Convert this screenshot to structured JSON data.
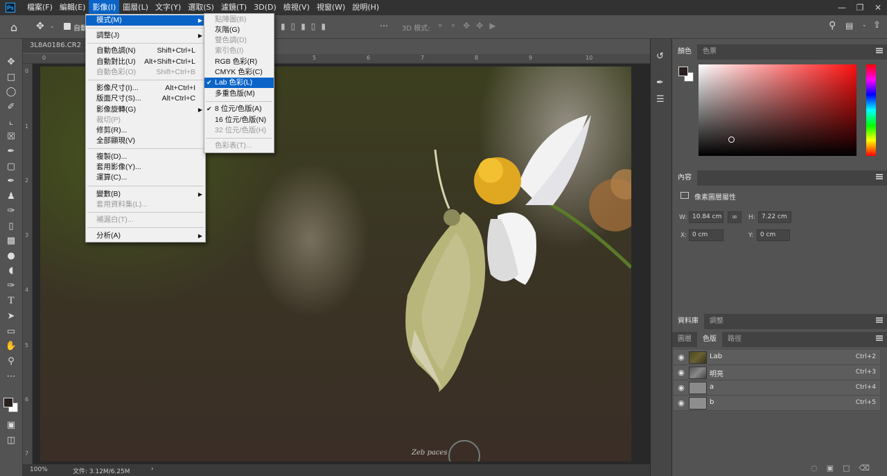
{
  "menubar": {
    "logo": "Ps",
    "items": [
      "檔案(F)",
      "編輯(E)",
      "影像(I)",
      "圖層(L)",
      "文字(Y)",
      "選取(S)",
      "濾鏡(T)",
      "3D(D)",
      "檢視(V)",
      "視窗(W)",
      "說明(H)"
    ]
  },
  "optbar": {
    "auto_select": "自動",
    "mode3d": "3D 模式:"
  },
  "document": {
    "tab": "3L8A0186.CR2 @",
    "ruler_top": [
      "0",
      "1",
      "2",
      "3",
      "4",
      "5",
      "6",
      "7",
      "8",
      "9",
      "10"
    ],
    "ruler_left": [
      "0",
      "1",
      "2",
      "3",
      "4",
      "5",
      "6",
      "7"
    ],
    "watermark": "Zeb paces",
    "status": {
      "zoom": "100%",
      "file": "文件: 3.12M/6.25M"
    }
  },
  "image_menu": {
    "items": [
      {
        "label": "模式(M)",
        "submenu": true,
        "highlight": true
      },
      {
        "label": "調整(J)",
        "submenu": true
      },
      {
        "label": "自動色調(N)",
        "shortcut": "Shift+Ctrl+L"
      },
      {
        "label": "自動對比(U)",
        "shortcut": "Alt+Shift+Ctrl+L"
      },
      {
        "label": "自動色彩(O)",
        "shortcut": "Shift+Ctrl+B",
        "disabled": true
      },
      {
        "label": "影像尺寸(I)...",
        "shortcut": "Alt+Ctrl+I"
      },
      {
        "label": "版面尺寸(S)...",
        "shortcut": "Alt+Ctrl+C"
      },
      {
        "label": "影像旋轉(G)",
        "submenu": true
      },
      {
        "label": "裁切(P)",
        "disabled": true
      },
      {
        "label": "修剪(R)..."
      },
      {
        "label": "全部顯現(V)"
      },
      {
        "label": "複製(D)..."
      },
      {
        "label": "套用影像(Y)..."
      },
      {
        "label": "運算(C)..."
      },
      {
        "label": "變數(B)",
        "submenu": true
      },
      {
        "label": "套用資料集(L)...",
        "disabled": true
      },
      {
        "label": "補漏白(T)...",
        "disabled": true
      },
      {
        "label": "分析(A)",
        "submenu": true
      }
    ]
  },
  "mode_submenu": {
    "items": [
      {
        "label": "點陣圖(B)",
        "disabled": true
      },
      {
        "label": "灰階(G)"
      },
      {
        "label": "雙色調(D)",
        "disabled": true
      },
      {
        "label": "索引色(I)",
        "disabled": true
      },
      {
        "label": "RGB 色彩(R)"
      },
      {
        "label": "CMYK 色彩(C)"
      },
      {
        "label": "Lab 色彩(L)",
        "checked": true,
        "highlight": true
      },
      {
        "label": "多重色版(M)"
      },
      {
        "label": "8 位元/色版(A)",
        "checked": true
      },
      {
        "label": "16 位元/色版(N)"
      },
      {
        "label": "32 位元/色版(H)",
        "disabled": true
      },
      {
        "label": "色彩表(T)...",
        "disabled": true
      }
    ]
  },
  "color_panel": {
    "tabs": [
      "顏色",
      "色票"
    ],
    "foreground": "#2a2020",
    "background": "#ffffff"
  },
  "properties_panel": {
    "title": "內容",
    "subtitle": "像素圖層屬性",
    "w_label": "W:",
    "w_value": "10.84 cm",
    "h_label": "H:",
    "h_value": "7.22 cm",
    "x_label": "X:",
    "x_value": "0 cm",
    "y_label": "Y:",
    "y_value": "0 cm"
  },
  "library_tabs": [
    "資料庫",
    "調整"
  ],
  "layer_tabs": [
    "圖層",
    "色版",
    "路徑"
  ],
  "channels": [
    {
      "name": "Lab",
      "shortcut": "Ctrl+2"
    },
    {
      "name": "明亮",
      "shortcut": "Ctrl+3"
    },
    {
      "name": "a",
      "shortcut": "Ctrl+4"
    },
    {
      "name": "b",
      "shortcut": "Ctrl+5"
    }
  ]
}
